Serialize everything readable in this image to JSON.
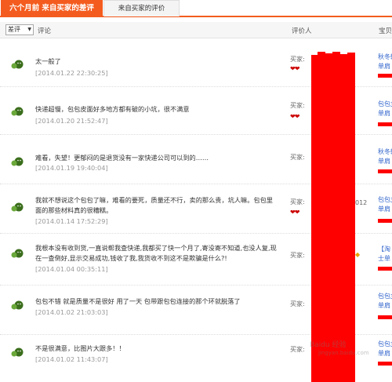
{
  "tabs": [
    {
      "label": "六个月前 来自买家的差评"
    },
    {
      "label": "来自买家的评价"
    }
  ],
  "header": {
    "filter": "差评",
    "comment_col": "评论",
    "reviewer_col": "评价人",
    "item_col": "宝贝"
  },
  "rows": [
    {
      "text": "太一般了",
      "date": "[2014.01.22 22:30:25]",
      "buyer": "买家:",
      "hearts": "❤❤",
      "item1": "秋冬韩",
      "item2": "单肩"
    },
    {
      "text": "快递超慢，包包皮面好多地方都有破的小坑，很不满意",
      "date": "[2014.01.20 21:52:47]",
      "buyer": "买家:",
      "hearts": "❤❤",
      "item1": "包包女",
      "item2": "单肩"
    },
    {
      "text": "难看，失望！更郁闷的是退货没有一家快递公司可以到的……",
      "date": "[2014.01.19 19:40:04]",
      "buyer": "买家:",
      "hearts": "",
      "item1": "秋冬韩",
      "item2": "单肩"
    },
    {
      "text": "我就不想说这个包包了嘛，难看的要死，质量还不行，卖的那么贵，坑人嘛。包包里面的那些材料真的很糟糕。",
      "date": "[2014.01.14 17:52:29]",
      "buyer": "买家:",
      "hearts": "❤❤",
      "fragment": "012",
      "item1": "包包女",
      "item2": "单肩"
    },
    {
      "text": "我根本没有收到货,一直说帮我查快递,我都买了快一个月了,寄没寄不知道,也没人复,现在一查倒好,显示交易成功,钱收了我,我货收不到这不是欺骗是什么?!",
      "date": "[2014.01.04 00:35:11]",
      "buyer": "买家:",
      "hearts": "",
      "item1": "【淘",
      "item2": "士单"
    },
    {
      "text": "包包不错 就是质量不是很好 用了一天 包带跟包包连接的那个环就脱落了",
      "date": "[2014.01.02 21:03:03]",
      "buyer": "买家:",
      "hearts": "",
      "item1": "包包女",
      "item2": "单肩"
    },
    {
      "text": "不是很满意，比图片大跟多！！",
      "date": "[2014.01.02 11:43:07]",
      "buyer": "买家:",
      "hearts": "",
      "item1": "包包女",
      "item2": "单肩"
    }
  ],
  "watermark": {
    "line1": "Baidu 经验",
    "line2": "jingyan.baidu.com"
  },
  "colors": {
    "tab_active": "#f45c1f",
    "redaction": "#ff0000",
    "date": "#999999"
  }
}
